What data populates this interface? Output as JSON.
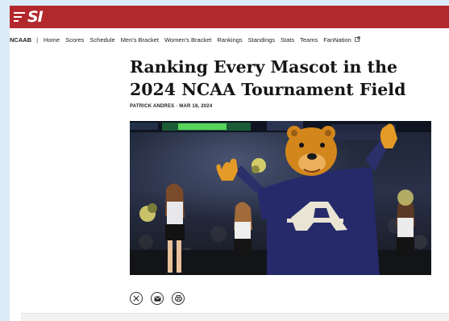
{
  "header": {
    "logo_text": "SI",
    "menu_icon": "hamburger-menu-icon",
    "brand_color": "#b3282d"
  },
  "nav": {
    "brand": "NCAAB",
    "separator": "|",
    "items": [
      "Home",
      "Scores",
      "Schedule",
      "Men's Bracket",
      "Women's Bracket",
      "Rankings",
      "Standings",
      "Stats",
      "Teams",
      "FanNation"
    ],
    "external_icon": "external-link-icon"
  },
  "article": {
    "headline": "Ranking Every Mascot in the 2024 NCAA Tournament Field",
    "byline": "PATRICK ANDRES · MAR 18, 2024",
    "share": {
      "icons": [
        "x-twitter-icon",
        "email-icon",
        "print-icon"
      ]
    }
  }
}
